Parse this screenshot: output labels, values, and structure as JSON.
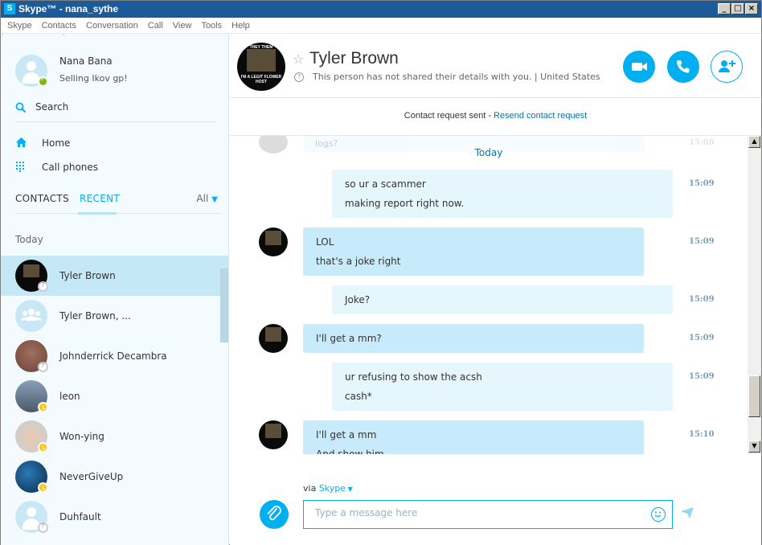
{
  "window": {
    "title": "Skype™ - nana_sythe",
    "logo_letter": "S",
    "controls": {
      "minimize": "_",
      "maximize": "□",
      "close": "×"
    }
  },
  "menu": [
    "Skype",
    "Contacts",
    "Conversation",
    "Call",
    "View",
    "Tools",
    "Help"
  ],
  "profile": {
    "name": "Nana Bana",
    "mood": "Selling Ikov gp!",
    "status": "online"
  },
  "sidebar": {
    "search_label": "Search",
    "nav": [
      {
        "label": "Home",
        "icon": "home-icon"
      },
      {
        "label": "Call phones",
        "icon": "dialpad-icon"
      }
    ],
    "tabs": {
      "contacts": "CONTACTS",
      "recent": "RECENT",
      "filter": "All"
    },
    "section_label": "Today",
    "contacts": [
      {
        "name": "Tyler Brown",
        "status": "unknown",
        "active": true
      },
      {
        "name": "Tyler Brown, ...",
        "status": "group",
        "active": false
      },
      {
        "name": "Johnderrick Decambra",
        "status": "unknown",
        "active": false
      },
      {
        "name": "leon",
        "status": "away",
        "active": false
      },
      {
        "name": "Won-ying",
        "status": "away",
        "active": false
      },
      {
        "name": "NeverGiveUp",
        "status": "away",
        "active": false
      },
      {
        "name": "Duhfault",
        "status": "unknown",
        "active": false
      }
    ]
  },
  "conversation": {
    "contact_name": "Tyler Brown",
    "info": "This person has not shared their details with you.  |  United States",
    "avatar_text_top": "THEY THEM",
    "avatar_text_bottom": "I'M A LEGIT FLOWER HOST",
    "request_text": "Contact request sent - ",
    "request_link": "Resend contact request",
    "ghost_text": "logs?",
    "ghost_time": "15:08",
    "day_separator": "Today",
    "messages": [
      {
        "from": "me",
        "lines": [
          "so ur a scammer",
          "making report right now."
        ],
        "time": "15:09"
      },
      {
        "from": "them",
        "lines": [
          "LOL",
          "that's a joke right"
        ],
        "time": "15:09"
      },
      {
        "from": "me",
        "lines": [
          "Joke?"
        ],
        "time": "15:09"
      },
      {
        "from": "them",
        "lines": [
          "I'll get a mm?"
        ],
        "time": "15:09"
      },
      {
        "from": "me",
        "lines": [
          "ur refusing to show the acsh",
          "cash*"
        ],
        "time": "15:09"
      },
      {
        "from": "them",
        "lines": [
          "I'll get a mm",
          "And show him"
        ],
        "time": "15:10"
      }
    ],
    "via_label": "via ",
    "via_service": "Skype",
    "input_placeholder": "Type a message here"
  },
  "colors": {
    "accent": "#00aff0",
    "active_row": "#c5e8f7",
    "bubble_mine": "#e5f6fd",
    "bubble_theirs": "#c7ebfa"
  }
}
